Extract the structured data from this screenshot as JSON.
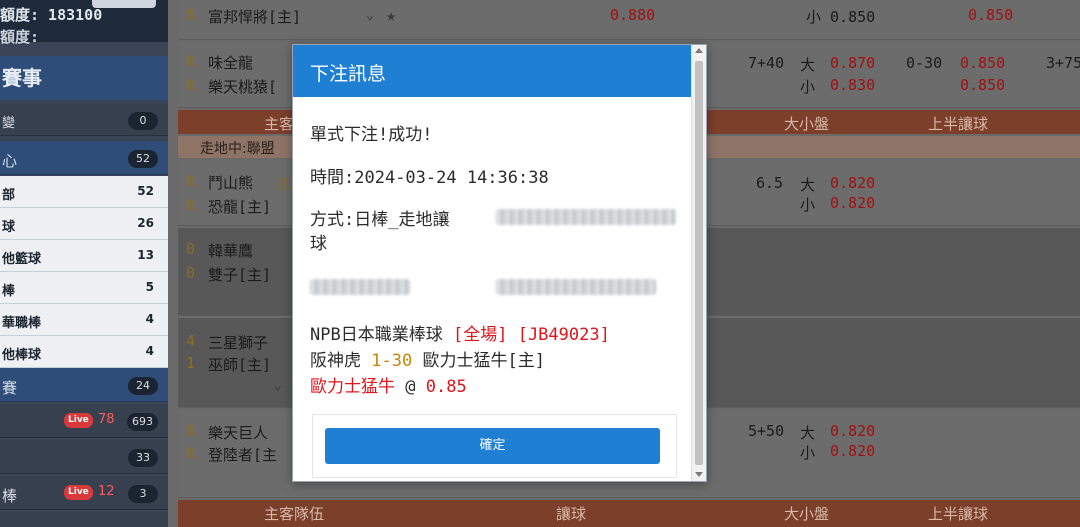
{
  "sidebar": {
    "credit_line": "額度: 183100",
    "credit_line2": "額度:",
    "section_events": "賽事",
    "rows": [
      {
        "label": "變",
        "count": "0"
      },
      {
        "label": "心",
        "count": "52"
      }
    ],
    "sports": [
      {
        "label": "部",
        "count": "52"
      },
      {
        "label": "球",
        "count": "26"
      },
      {
        "label": "他籃球",
        "count": "13"
      },
      {
        "label": "棒",
        "count": "5"
      },
      {
        "label": "華職棒",
        "count": "4"
      },
      {
        "label": "他棒球",
        "count": "4"
      }
    ],
    "section_match": "賽",
    "section_match_count": "24",
    "live_rows": [
      {
        "label": "",
        "live_tag": "Live",
        "live_count": "78",
        "count": "693"
      },
      {
        "label": "",
        "live_tag": "",
        "live_count": "",
        "count": "33"
      },
      {
        "label": "棒",
        "live_tag": "Live",
        "live_count": "12",
        "count": "3"
      }
    ]
  },
  "main": {
    "games": [
      {
        "score1": "0",
        "team1": "富邦悍將[主]",
        "hdp": "",
        "ou_top": "",
        "ou_bottom": "",
        "odds_mid": "0.880",
        "ou_odds_top": "",
        "ou_odds_bottom": "小 0.850",
        "h1_odds": "0.850"
      },
      {
        "score1": "0",
        "team1": "味全龍",
        "score2": "0",
        "team2": "樂天桃猿[",
        "hdp": "7+40",
        "ou_top": "大",
        "ou_bottom": "小",
        "ou_odds_top": "0.870",
        "ou_odds_bottom": "0.830",
        "h1": "0-30",
        "h1_odds_top": "0.850",
        "h1_odds_bottom": "0.850",
        "extra": "3+75"
      },
      {
        "score1": "0",
        "team1": "鬥山熊",
        "team1_tag": "瓦",
        "score2": "0",
        "team2": "恐龍[主]",
        "hdp": "6.5",
        "ou_top": "大",
        "ou_bottom": "小",
        "ou_odds_top": "0.820",
        "ou_odds_bottom": "0.820"
      },
      {
        "score1": "0",
        "team1": "韓華鷹",
        "score2": "0",
        "team2": "雙子[主]"
      },
      {
        "score1": "4",
        "team1": "三星獅子",
        "score2": "1",
        "team2": "巫師[主]"
      },
      {
        "score1": "0",
        "team1": "樂天巨人",
        "score2": "0",
        "team2": "登陸者[主",
        "hdp": "5+50",
        "ou_top": "大",
        "ou_bottom": "小",
        "ou_odds_top": "0.820",
        "ou_odds_bottom": "0.820"
      }
    ],
    "header": {
      "home": "主客隊伍",
      "hdp": "讓球",
      "ou": "大小盤",
      "h1": "上半讓球"
    },
    "subheader": "走地中:聯盟"
  },
  "modal": {
    "title": "下注訊息",
    "result": "單式下注!成功!",
    "time_label": "時間:",
    "time_value": "2024-03-24 14:36:38",
    "method_label": "方式:",
    "method_value": "日棒_走地讓",
    "method_wrap": "球",
    "league": "NPB日本職業棒球",
    "period": "[全場]",
    "code": "[JB49023]",
    "team_home": "阪神虎",
    "handicap": "1-30",
    "team_away": "歐力士猛牛[主]",
    "pick": "歐力士猛牛",
    "at": "@",
    "odds": "0.85",
    "ok_label": "確定"
  },
  "colors": {
    "primary": "#1f7fd2",
    "red": "#e0151c",
    "gold": "#c8860a"
  }
}
